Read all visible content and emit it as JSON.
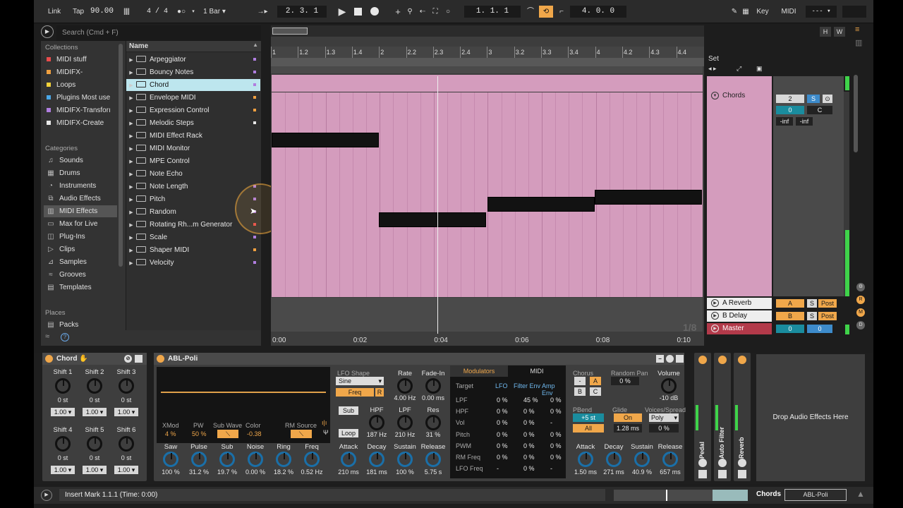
{
  "transport": {
    "link": "Link",
    "tap": "Tap",
    "tempo": "90.00",
    "signature": "4 / 4",
    "quantize": "1 Bar",
    "position": "2.   3.   1",
    "loop_start": "1.   1.   1",
    "loop_length": "4.   0.   0",
    "key": "Key",
    "midi": "MIDI",
    "cpu": "---",
    "h": "H",
    "w": "W"
  },
  "browser": {
    "search_placeholder": "Search (Cmd + F)",
    "collections_header": "Collections",
    "collections": [
      {
        "label": "MIDI stuff",
        "color": "#e94c4c"
      },
      {
        "label": "MIDIFX-",
        "color": "#f0a040"
      },
      {
        "label": "Loops",
        "color": "#f3d23a"
      },
      {
        "label": "Plugins Most use",
        "color": "#4aa8e8"
      },
      {
        "label": "MIDIFX-Transforı",
        "color": "#b07ee0"
      },
      {
        "label": "MIDIFX-Create",
        "color": "#e8e8e8"
      }
    ],
    "categories_header": "Categories",
    "categories": [
      {
        "label": "Sounds",
        "icon": "sounds-icon",
        "glyph": "♫"
      },
      {
        "label": "Drums",
        "icon": "drums-icon",
        "glyph": "▦"
      },
      {
        "label": "Instruments",
        "icon": "instruments-icon",
        "glyph": "◔"
      },
      {
        "label": "Audio Effects",
        "icon": "audio-effects-icon",
        "glyph": "⧉"
      },
      {
        "label": "MIDI Effects",
        "icon": "midi-effects-icon",
        "glyph": "▥"
      },
      {
        "label": "Max for Live",
        "icon": "max-for-live-icon",
        "glyph": "▭"
      },
      {
        "label": "Plug-Ins",
        "icon": "plugins-icon",
        "glyph": "◫"
      },
      {
        "label": "Clips",
        "icon": "clips-icon",
        "glyph": "▷"
      },
      {
        "label": "Samples",
        "icon": "samples-icon",
        "glyph": "⊿"
      },
      {
        "label": "Grooves",
        "icon": "grooves-icon",
        "glyph": "≈"
      },
      {
        "label": "Templates",
        "icon": "templates-icon",
        "glyph": "▤"
      }
    ],
    "places_header": "Places",
    "places": [
      {
        "label": "Packs"
      }
    ],
    "name_header": "Name",
    "items": [
      {
        "label": "Arpeggiator",
        "dot": "#b07ee0"
      },
      {
        "label": "Bouncy Notes",
        "dot": "#b07ee0"
      },
      {
        "label": "Chord",
        "dot": "#b07ee0"
      },
      {
        "label": "Envelope MIDI",
        "dot": "#f0a040"
      },
      {
        "label": "Expression Control",
        "dot": "#f0a040"
      },
      {
        "label": "Melodic Steps",
        "dot": "#e8e8e8"
      },
      {
        "label": "MIDI Effect Rack",
        "dot": ""
      },
      {
        "label": "MIDI Monitor",
        "dot": ""
      },
      {
        "label": "MPE Control",
        "dot": ""
      },
      {
        "label": "Note Echo",
        "dot": ""
      },
      {
        "label": "Note Length",
        "dot": "#b07ee0"
      },
      {
        "label": "Pitch",
        "dot": "#b07ee0"
      },
      {
        "label": "Random",
        "dot": "#b07ee0"
      },
      {
        "label": "Rotating Rh...m Generator",
        "dot": "#e94c4c"
      },
      {
        "label": "Scale",
        "dot": "#b07ee0"
      },
      {
        "label": "Shaper MIDI",
        "dot": "#f0a040"
      },
      {
        "label": "Velocity",
        "dot": "#b07ee0"
      }
    ]
  },
  "clip": {
    "ruler": [
      "1",
      "1.2",
      "1.3",
      "1.4",
      "2",
      "2.2",
      "2.3",
      "2.4",
      "3",
      "3.2",
      "3.3",
      "3.4",
      "4",
      "4.2",
      "4.3",
      "4.4"
    ],
    "times": [
      "0:00",
      "0:02",
      "0:04",
      "0:06",
      "0:08",
      "0:10"
    ],
    "grid_label": "1/8"
  },
  "session": {
    "set_label": "Set",
    "track_name": "Chords",
    "track_num": "2",
    "solo": "S",
    "pan": "0",
    "cue": "C",
    "vol_l": "-inf",
    "vol_r": "-inf",
    "returns": [
      {
        "name": "A Reverb",
        "letter": "A",
        "solo": "S",
        "post": "Post"
      },
      {
        "name": "B Delay",
        "letter": "B",
        "solo": "S",
        "post": "Post"
      }
    ],
    "master": {
      "name": "Master",
      "a": "0",
      "b": "0"
    }
  },
  "chord": {
    "title": "Chord",
    "shifts": [
      {
        "label": "Shift 1",
        "value": "0 st",
        "vel": "1.00"
      },
      {
        "label": "Shift 2",
        "value": "0 st",
        "vel": "1.00"
      },
      {
        "label": "Shift 3",
        "value": "0 st",
        "vel": "1.00"
      },
      {
        "label": "Shift 4",
        "value": "0 st",
        "vel": "1.00"
      },
      {
        "label": "Shift 5",
        "value": "0 st",
        "vel": "1.00"
      },
      {
        "label": "Shift 6",
        "value": "0 st",
        "vel": "1.00"
      }
    ]
  },
  "synth": {
    "title": "ABL-Poli",
    "osc": {
      "xmod_l": "XMod",
      "xmod_v": "4 %",
      "pw_l": "PW",
      "pw_v": "50 %",
      "sub_l": "Sub Wave",
      "color_l": "Color",
      "color_v": "-0.38",
      "rm_l": "RM Source"
    },
    "mix": [
      {
        "label": "Saw",
        "value": "100 %"
      },
      {
        "label": "Pulse",
        "value": "31.2 %"
      },
      {
        "label": "Sub",
        "value": "19.7 %"
      },
      {
        "label": "Noise",
        "value": "0.00 %"
      },
      {
        "label": "Ring",
        "value": "18.2 %"
      },
      {
        "label": "Freq",
        "value": "0.52 Hz"
      }
    ],
    "lfo": {
      "shape_l": "LFO Shape",
      "shape_v": "Sine",
      "freq": "Freq",
      "r": "R",
      "rate_l": "Rate",
      "rate_v": "4.00 Hz",
      "fade_l": "Fade-In",
      "fade_v": "0.00 ms"
    },
    "filt": {
      "sub": "Sub",
      "loop": "Loop",
      "hpf_l": "HPF",
      "hpf_v": "187 Hz",
      "lpf_l": "LPF",
      "lpf_v": "210 Hz",
      "res_l": "Res",
      "res_v": "31 %"
    },
    "env": [
      {
        "label": "Attack",
        "value": "210 ms"
      },
      {
        "label": "Decay",
        "value": "181 ms"
      },
      {
        "label": "Sustain",
        "value": "100 %"
      },
      {
        "label": "Release",
        "value": "5.75 s"
      }
    ],
    "mod": {
      "tab1": "Modulators",
      "tab2": "MIDI",
      "target": "Target",
      "c1": "LFO",
      "c2": "Filter Env",
      "c3": "Amp Env",
      "rows": [
        {
          "name": "LPF",
          "a": "0 %",
          "b": "45 %",
          "c": "0 %"
        },
        {
          "name": "HPF",
          "a": "0 %",
          "b": "0 %",
          "c": "0 %"
        },
        {
          "name": "Vol",
          "a": "0 %",
          "b": "0 %",
          "c": "-"
        },
        {
          "name": "Pitch",
          "a": "0 %",
          "b": "0 %",
          "c": "0 %"
        },
        {
          "name": "PWM",
          "a": "0 %",
          "b": "0 %",
          "c": "0 %"
        },
        {
          "name": "RM Freq",
          "a": "0 %",
          "b": "0 %",
          "c": "0 %"
        },
        {
          "name": "LFO Freq",
          "a": "-",
          "b": "0 %",
          "c": "-"
        }
      ]
    },
    "right": {
      "chorus_l": "Chorus",
      "rpan_l": "Random Pan",
      "rpan_v": "0 %",
      "vol_l": "Volume",
      "vol_v": "-10 dB",
      "off": "-",
      "a": "A",
      "b": "B",
      "c": "C",
      "pbend_l": "PBend",
      "pbend_v": "+5 st",
      "glide_l": "Glide",
      "glide_v": "On",
      "voices_l": "Voices/Spread",
      "voices_v": "Poly",
      "all": "All",
      "glide_t": "1.28 ms",
      "spread_v": "0 %"
    },
    "env2": [
      {
        "label": "Attack",
        "value": "1.50 ms"
      },
      {
        "label": "Decay",
        "value": "271 ms"
      },
      {
        "label": "Sustain",
        "value": "40.9 %"
      },
      {
        "label": "Release",
        "value": "657 ms"
      }
    ]
  },
  "collapsed": [
    "Pedal",
    "Auto Filter",
    "Reverb"
  ],
  "drop_text": "Drop Audio Effects Here",
  "status": {
    "text": "Insert Mark 1.1.1 (Time: 0:00)",
    "track": "Chords",
    "device": "ABL-Poli"
  }
}
